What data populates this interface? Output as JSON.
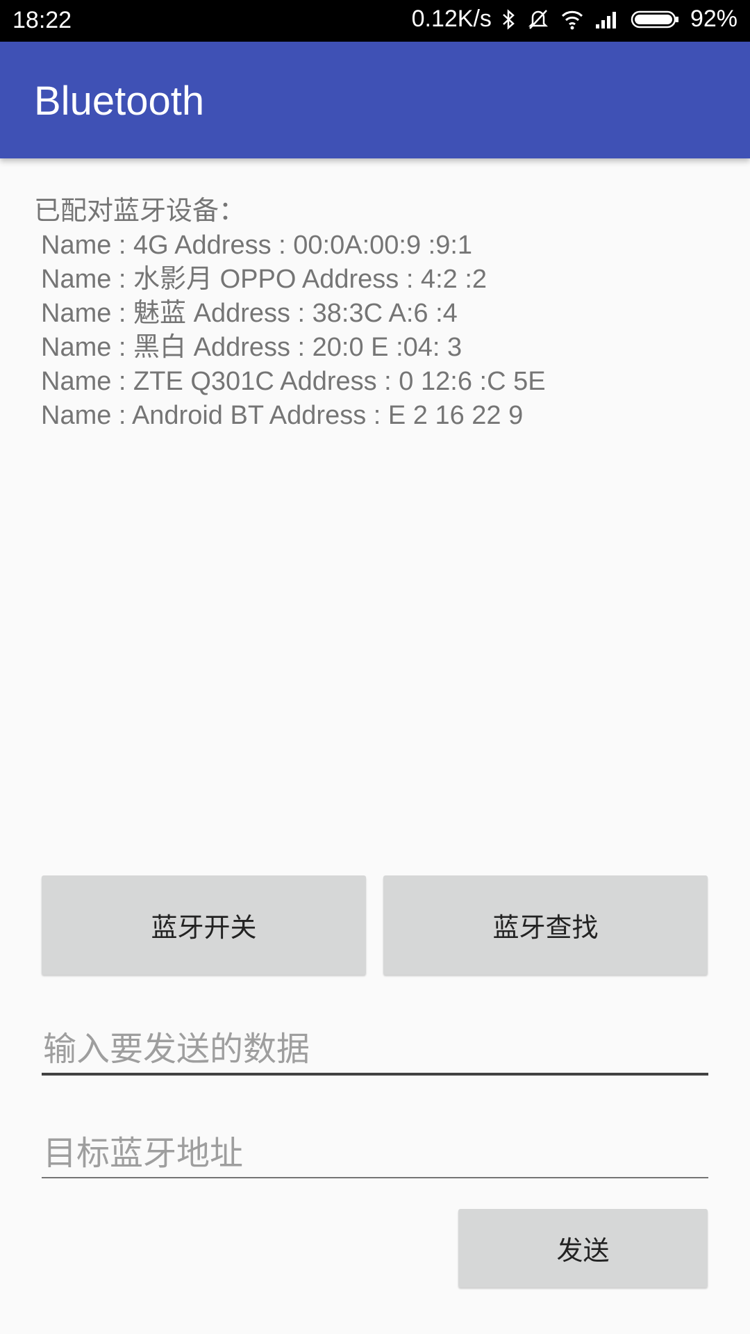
{
  "status_bar": {
    "time": "18:22",
    "net_speed": "0.12K/s",
    "battery": "92%",
    "icons": [
      "bluetooth-icon",
      "mute-icon",
      "wifi-icon",
      "signal-icon",
      "battery-icon"
    ]
  },
  "app_bar": {
    "title": "Bluetooth",
    "color": "#3f51b5"
  },
  "paired": {
    "heading": "已配对蓝牙设备：",
    "devices": [
      "Name : 4G Address : 00:0A:00:9 :9:1",
      "Name : 水影月 OPPO  Address : 4:2 :2",
      "Name : 魅蓝 Address : 38:3C A:6 :4",
      "Name : 黑白 Address : 20:0 E :04: 3",
      "Name : ZTE Q301C Address : 0 12:6 :C 5E",
      "Name : Android BT Address : E 2 16 22 9"
    ]
  },
  "buttons": {
    "toggle": "蓝牙开关",
    "search": "蓝牙查找",
    "send": "发送"
  },
  "inputs": {
    "data_placeholder": "输入要发送的数据",
    "address_placeholder": "目标蓝牙地址"
  }
}
